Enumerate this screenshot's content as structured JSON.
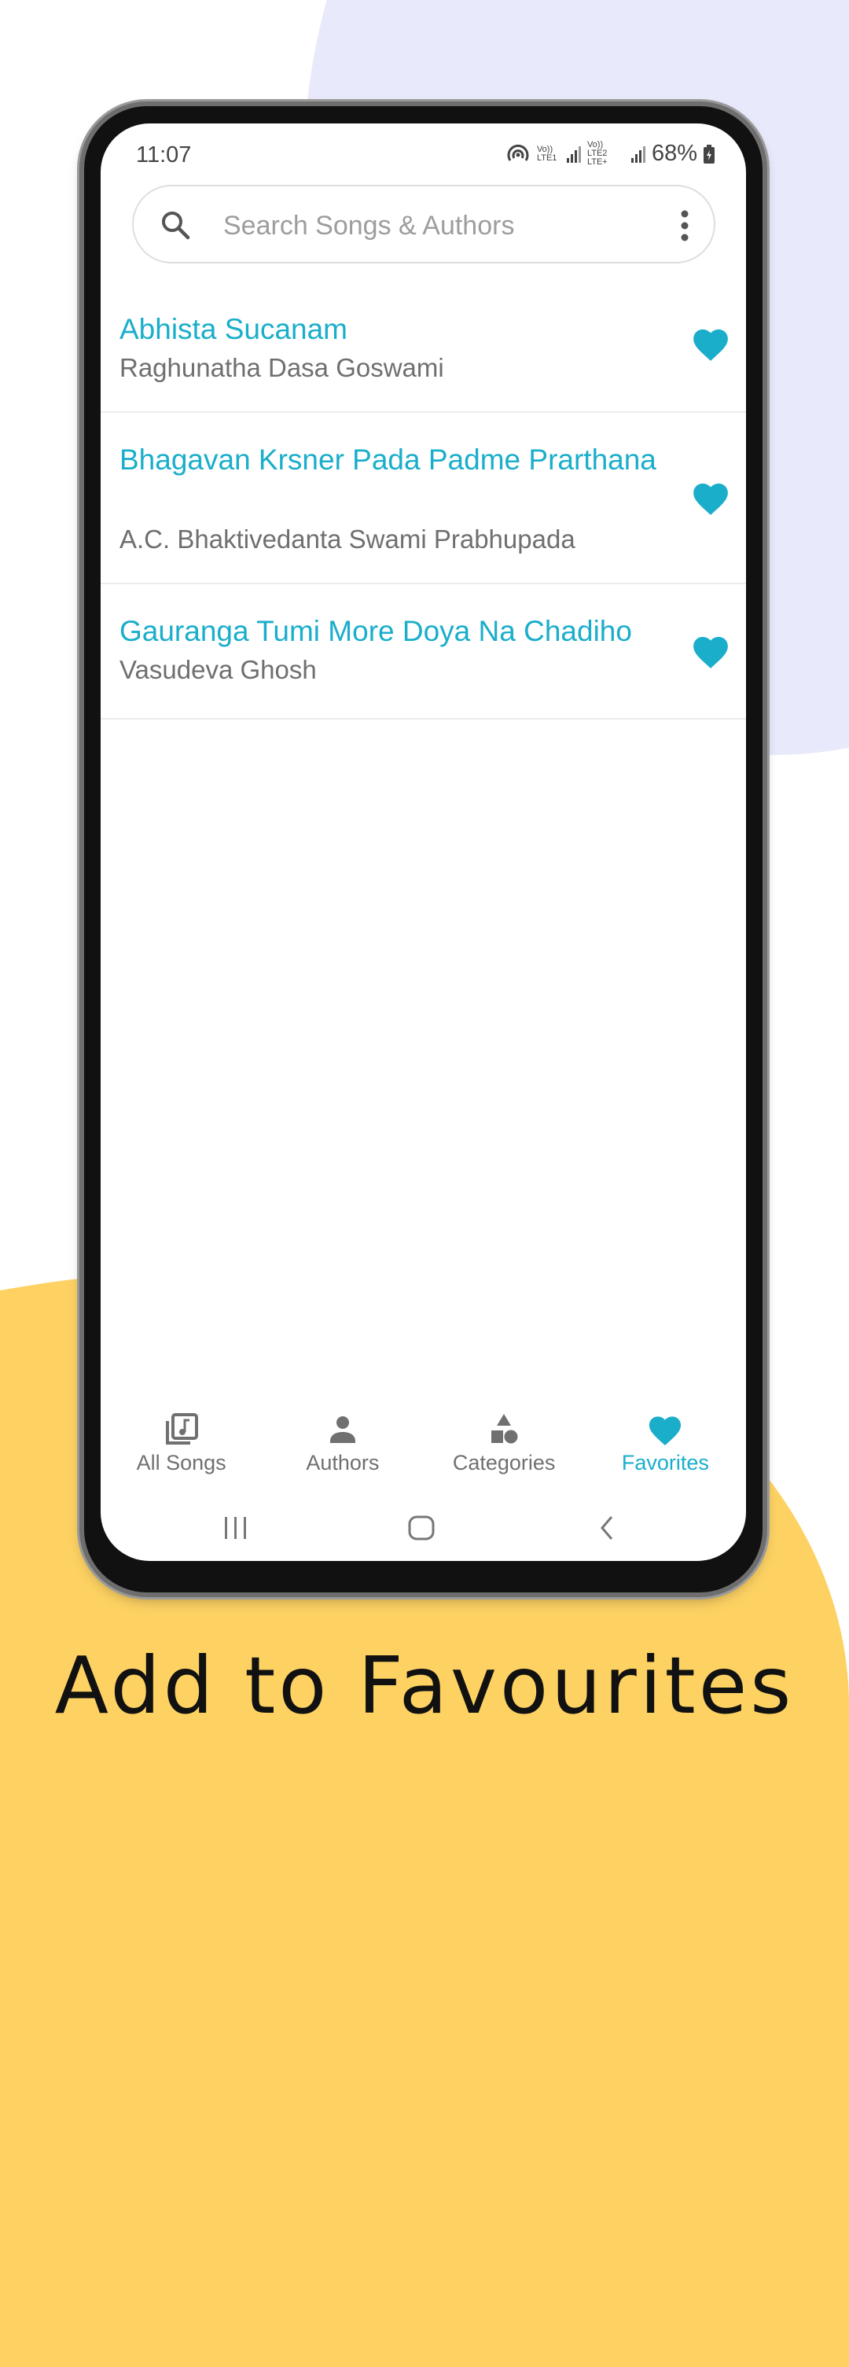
{
  "status_bar": {
    "time": "11:07",
    "network_1": "Vo)) LTE1",
    "network_2": "Vo)) LTE2 LTE+",
    "battery": "68%"
  },
  "search": {
    "placeholder": "Search Songs & Authors",
    "value": ""
  },
  "songs": [
    {
      "title": "Abhista Sucanam",
      "author": "Raghunatha Dasa Goswami",
      "favorite": true
    },
    {
      "title": "Bhagavan Krsner Pada Padme Prarthana",
      "author": "A.C. Bhaktivedanta Swami Prabhupada",
      "favorite": true
    },
    {
      "title": "Gauranga Tumi More Doya Na Chadiho",
      "author": "Vasudeva Ghosh",
      "favorite": true
    }
  ],
  "bottom_nav": {
    "active": "Favorites",
    "tabs": [
      {
        "label": "All Songs",
        "icon": "music-library-icon"
      },
      {
        "label": "Authors",
        "icon": "person-icon"
      },
      {
        "label": "Categories",
        "icon": "shapes-icon"
      },
      {
        "label": "Favorites",
        "icon": "heart-icon"
      }
    ]
  },
  "system_nav": [
    "recents",
    "home",
    "back"
  ],
  "caption": "Add to Favourites",
  "colors": {
    "accent": "#1aaecb",
    "background_yellow": "#fdd263",
    "background_lavender": "#e9e9fc"
  }
}
